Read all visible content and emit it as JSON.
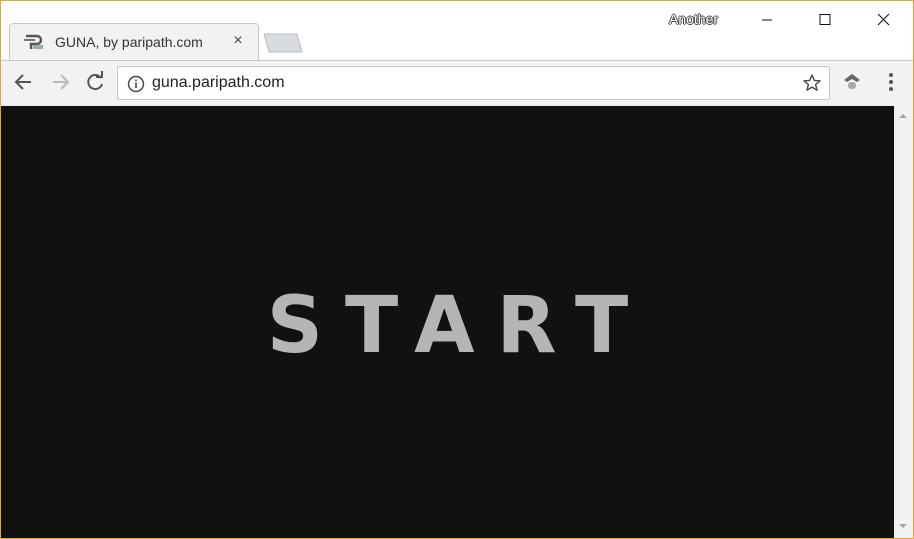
{
  "browser": {
    "tab_title": "GUNA, by paripath.com",
    "tab_close": "×",
    "profile_name": "Another",
    "url": "guna.paripath.com",
    "icons": {
      "favicon": "paripath-logo-icon",
      "back": "back-arrow-icon",
      "forward": "forward-arrow-icon",
      "reload": "reload-icon",
      "info": "info-icon",
      "bookmark": "star-icon",
      "extension": "extension-icon",
      "menu": "kebab-menu-icon"
    }
  },
  "page": {
    "start_label": "START",
    "background": "#0f120e",
    "text_color": "#b5b5b5"
  },
  "colors": {
    "window_border": "#e8a33b",
    "toolbar": "#f2f2f2"
  }
}
